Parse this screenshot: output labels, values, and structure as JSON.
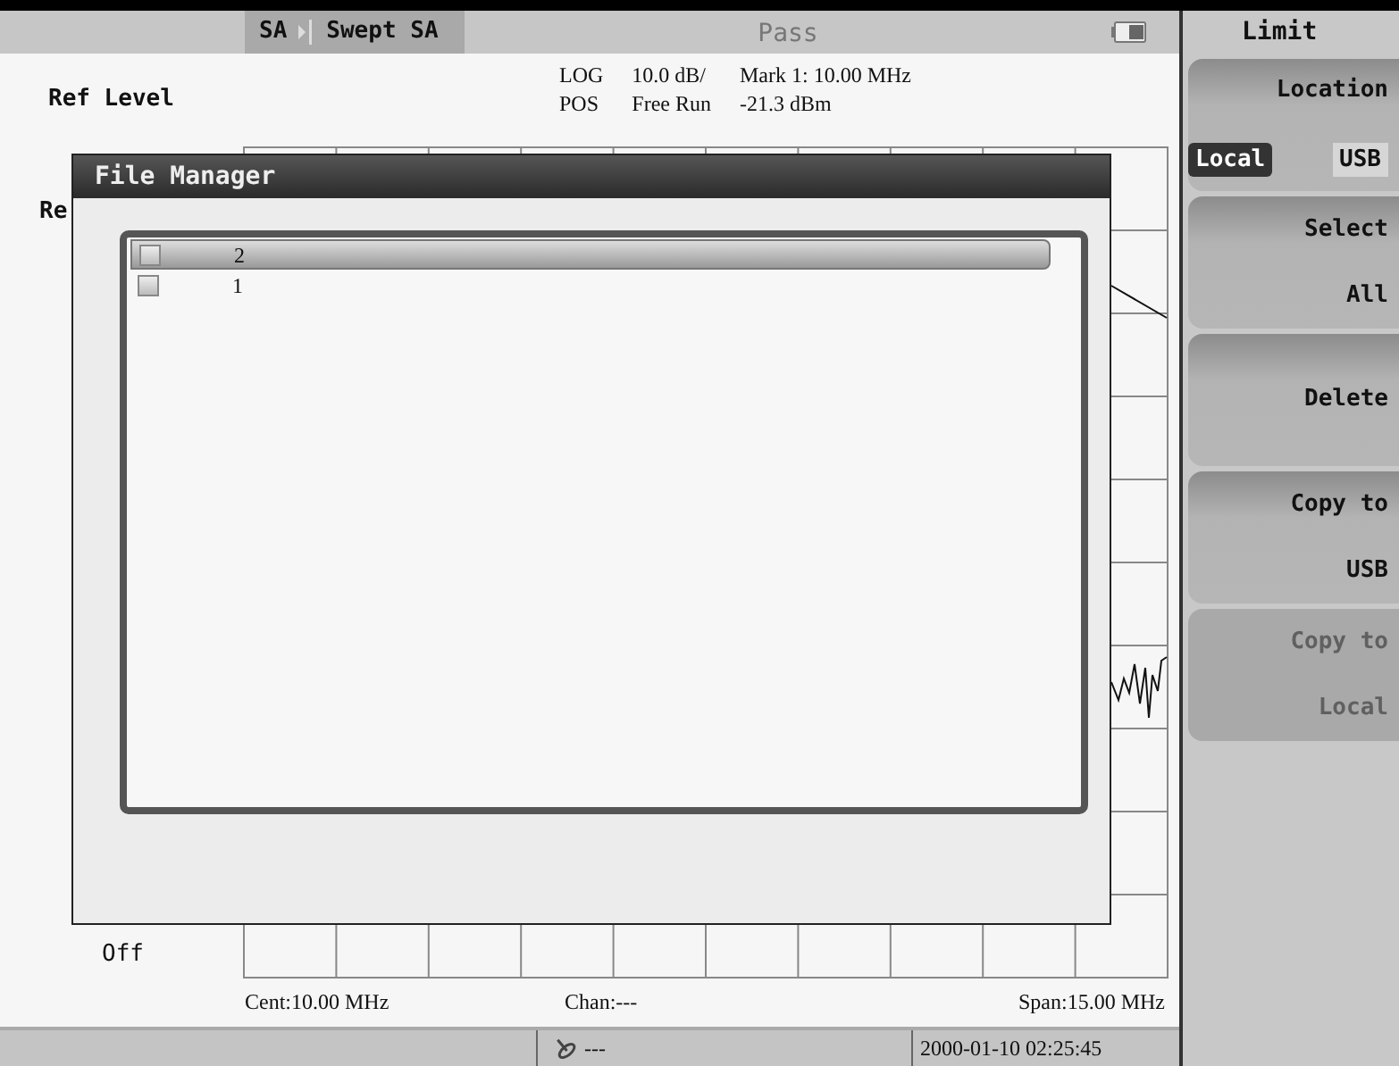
{
  "header": {
    "mode": "SA",
    "measurement": "Swept SA",
    "status": "Pass"
  },
  "info": {
    "ref_label": "Ref Level",
    "readouts": [
      [
        "LOG",
        "10.0 dB/",
        "Mark 1: 10.00 MHz"
      ],
      [
        "POS",
        "Free Run",
        "-21.3 dBm"
      ]
    ]
  },
  "plot": {
    "side_label": "Re",
    "footer_left": "Off"
  },
  "axis": {
    "center": "Cent:10.00 MHz",
    "channel": "Chan:---",
    "span": "Span:15.00 MHz"
  },
  "status_bar": {
    "gps": "---",
    "datetime": "2000-01-10 02:25:45"
  },
  "dialog": {
    "title": "File Manager",
    "files": [
      {
        "name": "2",
        "selected": true,
        "checked": false
      },
      {
        "name": "1",
        "selected": false,
        "checked": false
      }
    ]
  },
  "softkeys": {
    "title": "Limit",
    "keys": [
      {
        "kind": "toggle",
        "lines": [
          "Location"
        ],
        "options": [
          {
            "label": "Local",
            "selected": true
          },
          {
            "label": "USB",
            "selected": false
          }
        ],
        "disabled": false
      },
      {
        "kind": "button",
        "lines": [
          "Select",
          "All"
        ],
        "disabled": false
      },
      {
        "kind": "button",
        "lines": [
          "Delete"
        ],
        "disabled": false
      },
      {
        "kind": "button",
        "lines": [
          "Copy to",
          "USB"
        ],
        "disabled": false
      },
      {
        "kind": "button",
        "lines": [
          "Copy to",
          "Local"
        ],
        "disabled": true
      }
    ]
  }
}
